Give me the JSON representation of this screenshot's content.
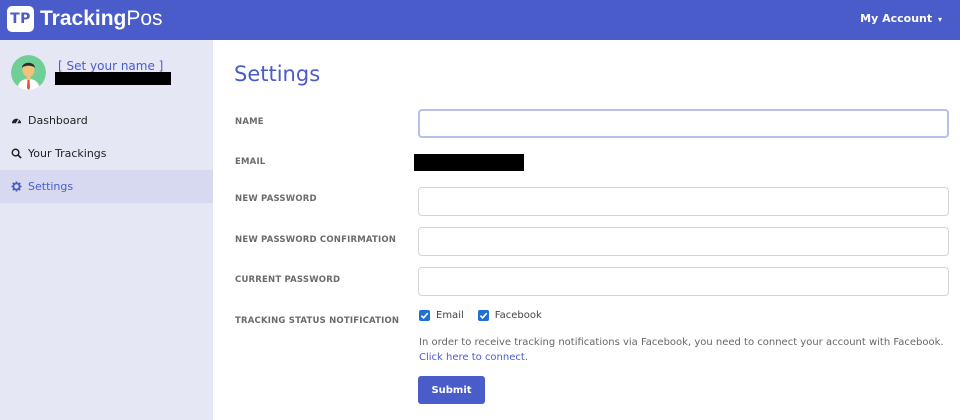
{
  "brand": {
    "badge": "TP",
    "name_bold": "Tracking",
    "name_light": "Pos"
  },
  "header": {
    "account_label": "My Account",
    "caret": "▾"
  },
  "sidebar": {
    "set_name_link": "[ Set your name ]",
    "items": [
      {
        "label": "Dashboard",
        "icon": "dashboard-icon"
      },
      {
        "label": "Your Trackings",
        "icon": "search-icon"
      },
      {
        "label": "Settings",
        "icon": "gear-icon",
        "active": true
      }
    ]
  },
  "main": {
    "title": "Settings",
    "fields": {
      "name": {
        "label": "NAME",
        "value": ""
      },
      "email": {
        "label": "EMAIL"
      },
      "new_password": {
        "label": "NEW PASSWORD",
        "value": ""
      },
      "new_password_confirmation": {
        "label": "NEW PASSWORD CONFIRMATION",
        "value": ""
      },
      "current_password": {
        "label": "CURRENT PASSWORD",
        "value": ""
      }
    },
    "notification": {
      "label": "TRACKING STATUS NOTIFICATION",
      "email_label": "Email",
      "facebook_label": "Facebook",
      "notice_text": "In order to receive tracking notifications via Facebook, you need to connect your account with Facebook. ",
      "notice_link": "Click here to connect",
      "notice_end": "."
    },
    "submit_label": "Submit"
  },
  "colors": {
    "accent": "#4a5cca",
    "sidebar_bg": "#e6e7f4",
    "checkbox": "#1f6fd6"
  }
}
